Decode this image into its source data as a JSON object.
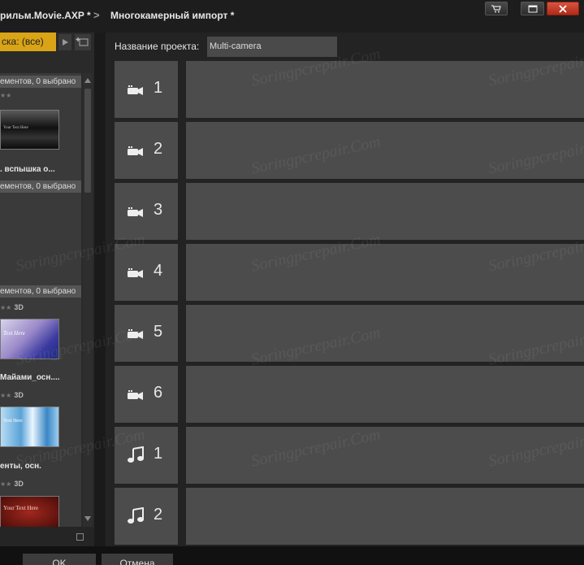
{
  "breadcrumb": {
    "project": "рильм.Movie.AXP *",
    "separator": ">",
    "current": "Многокамерный импорт *"
  },
  "window_buttons": [
    "cart-icon",
    "maximize-icon",
    "close-icon"
  ],
  "library": {
    "filter_tab": "ска: (все)",
    "groups": [
      {
        "header": "ементов, 0 выбрано"
      },
      {
        "header": "ементов, 0 выбрано"
      },
      {
        "header": "ементов, 0 выбрано"
      }
    ],
    "items": [
      {
        "title": ". вспышка о...",
        "thumb_text": "Your Text Here",
        "badge": ""
      },
      {
        "title": "Майами_осн....",
        "thumb_text": "Text Here",
        "badge": "3D"
      },
      {
        "title": "енты, осн.",
        "thumb_text": "Text Here",
        "badge": "3D"
      },
      {
        "title": "",
        "thumb_text": "Your Text Here",
        "badge": "3D"
      }
    ]
  },
  "project": {
    "label": "Название проекта:",
    "value": "Multi-camera"
  },
  "tracks": [
    {
      "type": "video",
      "icon": "camera-icon",
      "number": "1"
    },
    {
      "type": "video",
      "icon": "camera-icon",
      "number": "2"
    },
    {
      "type": "video",
      "icon": "camera-icon",
      "number": "3"
    },
    {
      "type": "video",
      "icon": "camera-icon",
      "number": "4"
    },
    {
      "type": "video",
      "icon": "camera-icon",
      "number": "5"
    },
    {
      "type": "video",
      "icon": "camera-icon",
      "number": "6"
    },
    {
      "type": "audio",
      "icon": "music-note-icon",
      "number": "1"
    },
    {
      "type": "audio",
      "icon": "music-note-icon",
      "number": "2"
    }
  ],
  "buttons": {
    "ok": "OK",
    "cancel": "Отмена"
  },
  "watermark": "Soringpcrepair.Com",
  "colors": {
    "accent_tab": "#d9a416",
    "close_button": "#c43b24",
    "track_bg": "#4c4c4c"
  }
}
